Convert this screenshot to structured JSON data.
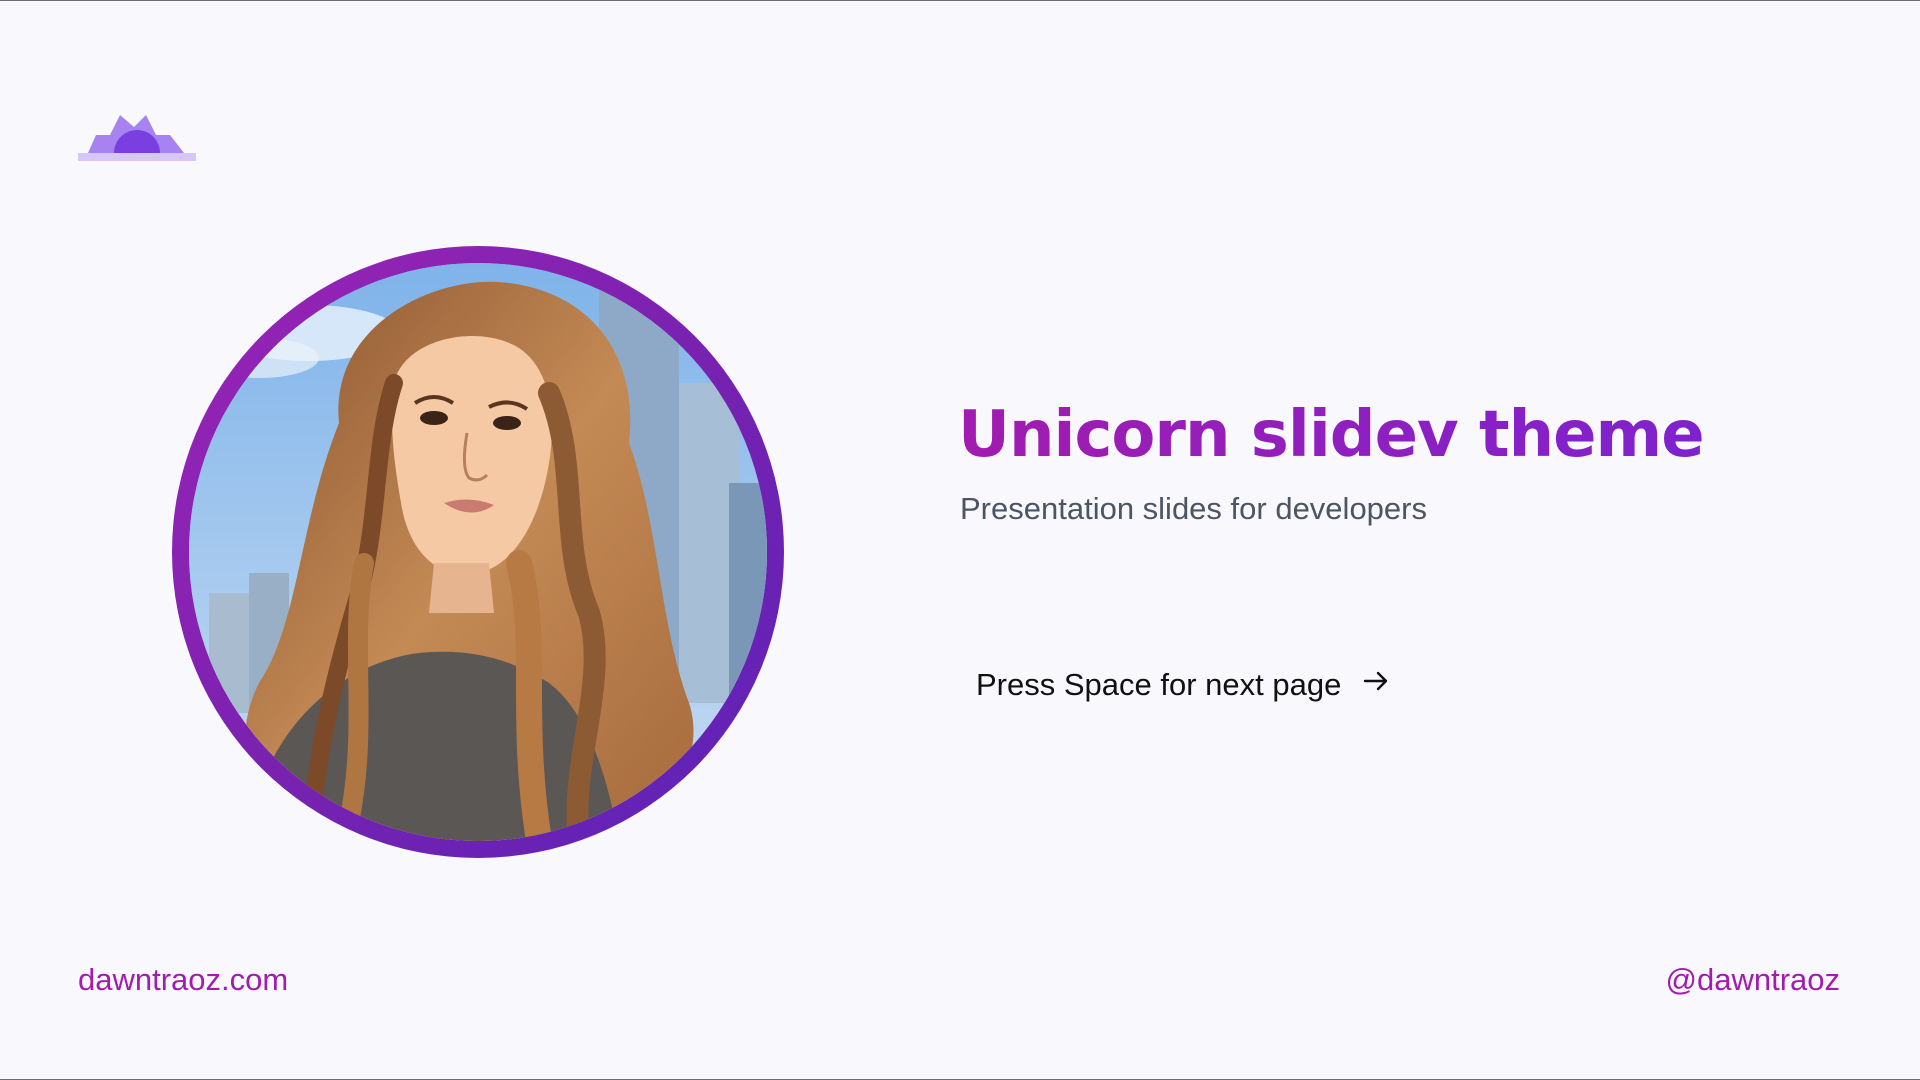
{
  "slide": {
    "logo_icon": "unicorn-lotus-logo-icon",
    "avatar_alt": "avatar-portrait",
    "title": "Unicorn slidev theme",
    "subtitle": "Presentation slides for developers",
    "next_label": "Press Space for next page",
    "next_icon": "arrow-right-icon",
    "footer_left": "dawntraoz.com",
    "footer_right": "@dawntraoz"
  },
  "colors": {
    "accent": "#a21caf",
    "accent_secondary": "#7e22ce",
    "background": "#f9f8fd",
    "subtitle_text": "#4b5563"
  }
}
